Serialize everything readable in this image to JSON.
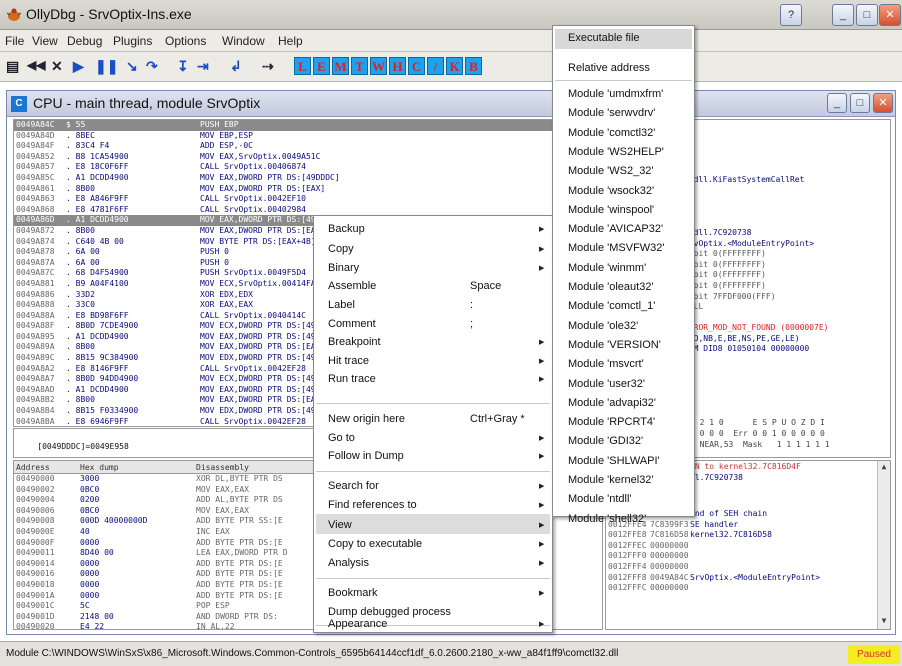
{
  "app": {
    "title": "OllyDbg - SrvOptix-Ins.exe"
  },
  "window_buttons": {
    "help": "?",
    "min": "_",
    "max": "□",
    "close": "✕"
  },
  "menu": [
    "File",
    "View",
    "Debug",
    "Plugins",
    "Options",
    "Window",
    "Help"
  ],
  "toolbar": {
    "buttons": [
      "▤",
      "◀◀",
      "✕",
      "▶",
      "❚❚",
      "↘",
      "↷",
      "↧",
      "⇥",
      "↲",
      "⇢"
    ],
    "letters": [
      "L",
      "E",
      "M",
      "T",
      "W",
      "H",
      "C",
      "/",
      "K",
      "B"
    ]
  },
  "cpu": {
    "title": "CPU - main thread, module SrvOptix",
    "icon_text": "C",
    "disasm_rows": [
      {
        "addr": "0049A84C",
        "hex": "$ 55",
        "instr": "PUSH EBP"
      },
      {
        "addr": "0049A84D",
        "hex": ". 8BEC",
        "instr": "MOV EBP,ESP"
      },
      {
        "addr": "0049A84F",
        "hex": ". 83C4 F4",
        "instr": "ADD ESP,-0C"
      },
      {
        "addr": "0049A852",
        "hex": ". B8 1CA54900",
        "instr": "MOV EAX,SrvOptix.0049A51C"
      },
      {
        "addr": "0049A857",
        "hex": ". E8 18C0F6FF",
        "instr": "CALL SrvOptix.00406874"
      },
      {
        "addr": "0049A85C",
        "hex": ". A1 DCDD4900",
        "instr": "MOV EAX,DWORD PTR DS:[49DDDC]"
      },
      {
        "addr": "0049A861",
        "hex": ". 8B00",
        "instr": "MOV EAX,DWORD PTR DS:[EAX]"
      },
      {
        "addr": "0049A863",
        "hex": ". E8 A846F9FF",
        "instr": "CALL SrvOptix.0042EF10"
      },
      {
        "addr": "0049A868",
        "hex": ". E8 4781F6FF",
        "instr": "CALL SrvOptix.00402984"
      },
      {
        "addr": "0049A86D",
        "hex": ". A1 DCDD4900",
        "instr": "MOV EAX,DWORD PTR DS:[49DDDC]"
      },
      {
        "addr": "0049A872",
        "hex": ". 8B00",
        "instr": "MOV EAX,DWORD PTR DS:[EAX]"
      },
      {
        "addr": "0049A874",
        "hex": ". C640 4B 00",
        "instr": "MOV BYTE PTR DS:[EAX+4B],0"
      },
      {
        "addr": "0049A878",
        "hex": ". 6A 00",
        "instr": "PUSH 0"
      },
      {
        "addr": "0049A87A",
        "hex": ". 6A 00",
        "instr": "PUSH 0"
      },
      {
        "addr": "0049A87C",
        "hex": ". 68 D4F54900",
        "instr": "PUSH SrvOptix.0049F5D4"
      },
      {
        "addr": "0049A881",
        "hex": ". B9 A04F4100",
        "instr": "MOV ECX,SrvOptix.00414FA0"
      },
      {
        "addr": "0049A886",
        "hex": ". 33D2",
        "instr": "XOR EDX,EDX"
      },
      {
        "addr": "0049A888",
        "hex": ". 33C0",
        "instr": "XOR EAX,EAX"
      },
      {
        "addr": "0049A88A",
        "hex": ". E8 BD98F6FF",
        "instr": "CALL SrvOptix.0040414C"
      },
      {
        "addr": "0049A88F",
        "hex": ". 8B0D 7CDE4900",
        "instr": "MOV ECX,DWORD PTR DS:[49DE7C]"
      },
      {
        "addr": "0049A895",
        "hex": ". A1 DCDD4900",
        "instr": "MOV EAX,DWORD PTR DS:[49DDDC]"
      },
      {
        "addr": "0049A89A",
        "hex": ". 8B00",
        "instr": "MOV EAX,DWORD PTR DS:[EAX]"
      },
      {
        "addr": "0049A89C",
        "hex": ". 8B15 9C384900",
        "instr": "MOV EDX,DWORD PTR DS:[49389C]"
      },
      {
        "addr": "0049A8A2",
        "hex": ". E8 8146F9FF",
        "instr": "CALL SrvOptix.0042EF28"
      },
      {
        "addr": "0049A8A7",
        "hex": ". 8B0D 94DD4900",
        "instr": "MOV ECX,DWORD PTR DS:[49DD94]"
      },
      {
        "addr": "0049A8AD",
        "hex": ". A1 DCDD4900",
        "instr": "MOV EAX,DWORD PTR DS:[49DDDC]"
      },
      {
        "addr": "0049A8B2",
        "hex": ". 8B00",
        "instr": "MOV EAX,DWORD PTR DS:[EAX]"
      },
      {
        "addr": "0049A8B4",
        "hex": ". 8B15 F0334900",
        "instr": "MOV EDX,DWORD PTR DS:[4933F0]"
      },
      {
        "addr": "0049A8BA",
        "hex": ". E8 6946F9FF",
        "instr": "CALL SrvOptix.0042EF28"
      }
    ],
    "info_line": "[0049DDDC]=0049E958",
    "registers": [
      "D)",
      "",
      "",
      "ntdll.KiFastSystemCallRet",
      "",
      "",
      "",
      "",
      "ntdll.7C920738",
      "SrvOptix.<ModuleEntryPoint>",
      "32bit 0(FFFFFFFF)",
      "32bit 0(FFFFFFFF)",
      "32bit 0(FFFFFFFF)",
      "32bit 0(FFFFFFFF)",
      "32bit 7FFDF000(FFF)",
      "NULL",
      "",
      "ERROR_MOD_NOT_FOUND (0000007E)",
      "(NO,NB,E,BE,NS,PE,GE,LE)",
      "ORM DID8 01050104 00000000"
    ],
    "fpu_bits": "3 2 1 0      E S P U O Z D I",
    "fpu_line1": "1 0 0 0  Err 0 0 1 0 0 0 0 0",
    "fpu_line2": "t NEAR,53  Mask   1 1 1 1 1 1",
    "dump_header": {
      "addr": "Address",
      "hex": "Hex dump",
      "dis": "Disassembly"
    },
    "dump_rows": [
      {
        "addr": "00490000",
        "hex": "3000",
        "dis": "XOR DL,BYTE PTR DS"
      },
      {
        "addr": "00490002",
        "hex": "0BC0",
        "dis": "MOV EAX,EAX"
      },
      {
        "addr": "00490004",
        "hex": "0200",
        "dis": "ADD AL,BYTE PTR DS"
      },
      {
        "addr": "00490006",
        "hex": "0BC0",
        "dis": "MOV EAX,EAX"
      },
      {
        "addr": "00490008",
        "hex": "000D 40000000D",
        "dis": "ADD BYTE PTR SS:[E"
      },
      {
        "addr": "0049000E",
        "hex": "40",
        "dis": "INC EAX"
      },
      {
        "addr": "0049000F",
        "hex": "0000",
        "dis": "ADD BYTE PTR DS:[E"
      },
      {
        "addr": "00490011",
        "hex": "8D40 00",
        "dis": "LEA EAX,DWORD PTR D"
      },
      {
        "addr": "00490014",
        "hex": "0000",
        "dis": "ADD BYTE PTR DS:[E"
      },
      {
        "addr": "00490016",
        "hex": "0000",
        "dis": "ADD BYTE PTR DS:[E"
      },
      {
        "addr": "00490018",
        "hex": "0000",
        "dis": "ADD BYTE PTR DS:[E"
      },
      {
        "addr": "0049001A",
        "hex": "0000",
        "dis": "ADD BYTE PTR DS:[E"
      },
      {
        "addr": "0049001C",
        "hex": "5C",
        "dis": "POP ESP"
      },
      {
        "addr": "0049001D",
        "hex": "2148 00",
        "dis": "AND DWORD PTR DS:"
      },
      {
        "addr": "00490020",
        "hex": "E4 22",
        "dis": "IN AL,22"
      },
      {
        "addr": "00490022",
        "hex": "40",
        "dis": "INC EAX"
      },
      {
        "addr": "00490023",
        "hex": "0058 26",
        "dis": "ADD BYTE PTR DS:[E"
      }
    ],
    "stack_rows": [
      {
        "addr": "0012FFE0",
        "val": "FFFFFFFF",
        "comment": "End of SEH chain"
      },
      {
        "addr": "0012FFE4",
        "val": "7C8399F3",
        "comment": "SE handler"
      },
      {
        "addr": "0012FFE8",
        "val": "7C816D58",
        "comment": "kernel32.7C816D58"
      },
      {
        "addr": "0012FFEC",
        "val": "00000000",
        "comment": ""
      },
      {
        "addr": "0012FFF0",
        "val": "00000000",
        "comment": ""
      },
      {
        "addr": "0012FFF4",
        "val": "00000000",
        "comment": ""
      },
      {
        "addr": "0012FFF8",
        "val": "0049A84C",
        "comment": "SrvOptix.<ModuleEntryPoint>"
      },
      {
        "addr": "0012FFFC",
        "val": "00000000",
        "comment": ""
      }
    ],
    "stack_top_text": "RN to kernel32.7C816D4F",
    "stack_top_text2": "ll.7C920738"
  },
  "context_menu": {
    "items": [
      {
        "label": "Backup",
        "shortcut": "",
        "sub": true
      },
      {
        "label": "Copy",
        "shortcut": "",
        "sub": true
      },
      {
        "label": "Binary",
        "shortcut": "",
        "sub": true
      },
      {
        "label": "Assemble",
        "shortcut": "Space",
        "sub": false
      },
      {
        "label": "Label",
        "shortcut": ":",
        "sub": false
      },
      {
        "label": "Comment",
        "shortcut": ";",
        "sub": false
      },
      {
        "label": "Breakpoint",
        "shortcut": "",
        "sub": true
      },
      {
        "label": "Hit trace",
        "shortcut": "",
        "sub": true
      },
      {
        "label": "Run trace",
        "shortcut": "",
        "sub": true
      },
      {
        "label": "New origin here",
        "shortcut": "Ctrl+Gray *",
        "sub": false
      },
      {
        "label": "Go to",
        "shortcut": "",
        "sub": true
      },
      {
        "label": "Follow in Dump",
        "shortcut": "",
        "sub": true
      },
      {
        "label": "Search for",
        "shortcut": "",
        "sub": true
      },
      {
        "label": "Find references to",
        "shortcut": "",
        "sub": true
      },
      {
        "label": "View",
        "shortcut": "",
        "sub": true
      },
      {
        "label": "Copy to executable",
        "shortcut": "",
        "sub": true
      },
      {
        "label": "Analysis",
        "shortcut": "",
        "sub": true
      },
      {
        "label": "Bookmark",
        "shortcut": "",
        "sub": true
      },
      {
        "label": "Dump debugged process",
        "shortcut": "",
        "sub": false
      },
      {
        "label": "Appearance",
        "shortcut": "",
        "sub": true
      }
    ]
  },
  "submenu": {
    "items": [
      "Executable file",
      "Relative address",
      "Module 'umdmxfrm'",
      "Module 'serwvdrv'",
      "Module 'comctl32'",
      "Module 'WS2HELP'",
      "Module 'WS2_32'",
      "Module 'wsock32'",
      "Module 'winspool'",
      "Module 'AVICAP32'",
      "Module 'MSVFW32'",
      "Module 'winmm'",
      "Module 'oleaut32'",
      "Module 'comctl_1'",
      "Module 'ole32'",
      "Module 'VERSION'",
      "Module 'msvcrt'",
      "Module 'user32'",
      "Module 'advapi32'",
      "Module 'RPCRT4'",
      "Module 'GDI32'",
      "Module 'SHLWAPI'",
      "Module 'kernel32'",
      "Module 'ntdll'",
      "Module 'shell32'"
    ]
  },
  "status": {
    "text": "Module C:\\WINDOWS\\WinSxS\\x86_Microsoft.Windows.Common-Controls_6595b64144ccf1df_6.0.2600.2180_x-ww_a84f1ff9\\comctl32.dll",
    "state": "Paused"
  },
  "colors": {
    "selection": "#8a8a8a",
    "accent": "#1aa3f0",
    "paused": "#f2ee22",
    "error_text": "#e02020"
  }
}
